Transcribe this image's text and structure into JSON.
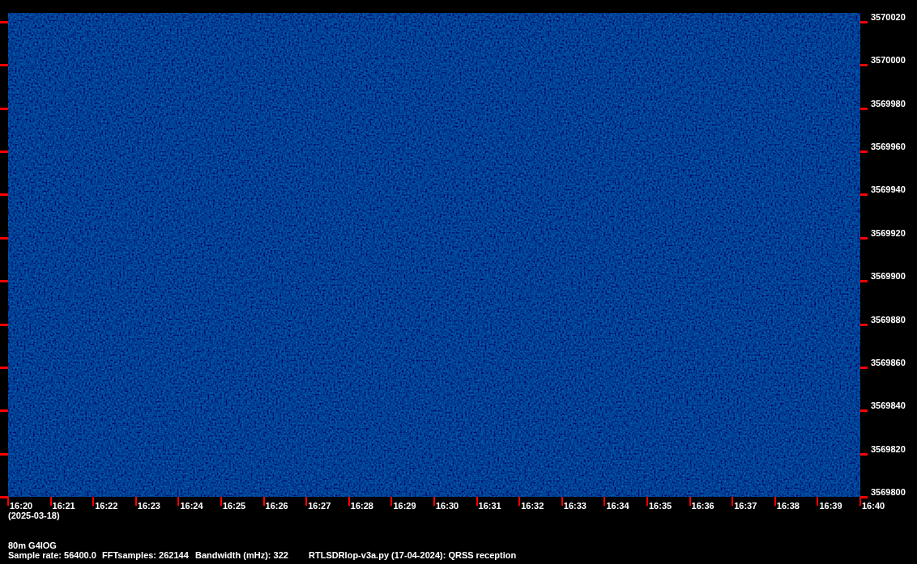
{
  "frequency_axis": {
    "labels": [
      "3570020",
      "3570000",
      "3569980",
      "3569960",
      "3569940",
      "3569920",
      "3569900",
      "3569880",
      "3569860",
      "3569840",
      "3569820",
      "3569800"
    ]
  },
  "time_axis": {
    "labels": [
      "16:20",
      "16:21",
      "16:22",
      "16:23",
      "16:24",
      "16:25",
      "16:26",
      "16:27",
      "16:28",
      "16:29",
      "16:30",
      "16:31",
      "16:32",
      "16:33",
      "16:34",
      "16:35",
      "16:36",
      "16:37",
      "16:38",
      "16:39",
      "16:40"
    ],
    "date": "(2025-03-18)"
  },
  "station": "80m G4IOG",
  "info": [
    "Sample rate: 56400.0",
    "FFTsamples: 262144",
    "Bandwidth (mHz): 322",
    "RTLSDRlop-v3a.py (17-04-2024): QRSS reception"
  ]
}
